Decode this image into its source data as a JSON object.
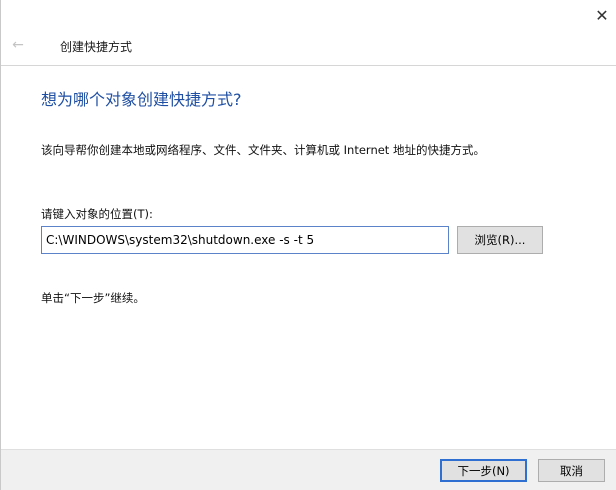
{
  "window": {
    "title": "创建快捷方式",
    "back_icon": "←",
    "close_icon": "✕"
  },
  "main": {
    "heading": "想为哪个对象创建快捷方式?",
    "description": "该向导帮你创建本地或网络程序、文件、文件夹、计算机或 Internet 地址的快捷方式。",
    "location_label": "请键入对象的位置(T):",
    "location_value": "C:\\WINDOWS\\system32\\shutdown.exe -s -t 5",
    "browse_label": "浏览(R)...",
    "continue_hint": "单击“下一步”继续。"
  },
  "footer": {
    "next_label": "下一步(N)",
    "cancel_label": "取消"
  },
  "colors": {
    "heading": "#1f4fa3",
    "focus_border": "#2f6fd1",
    "footer_bg": "#f0f0f0"
  }
}
